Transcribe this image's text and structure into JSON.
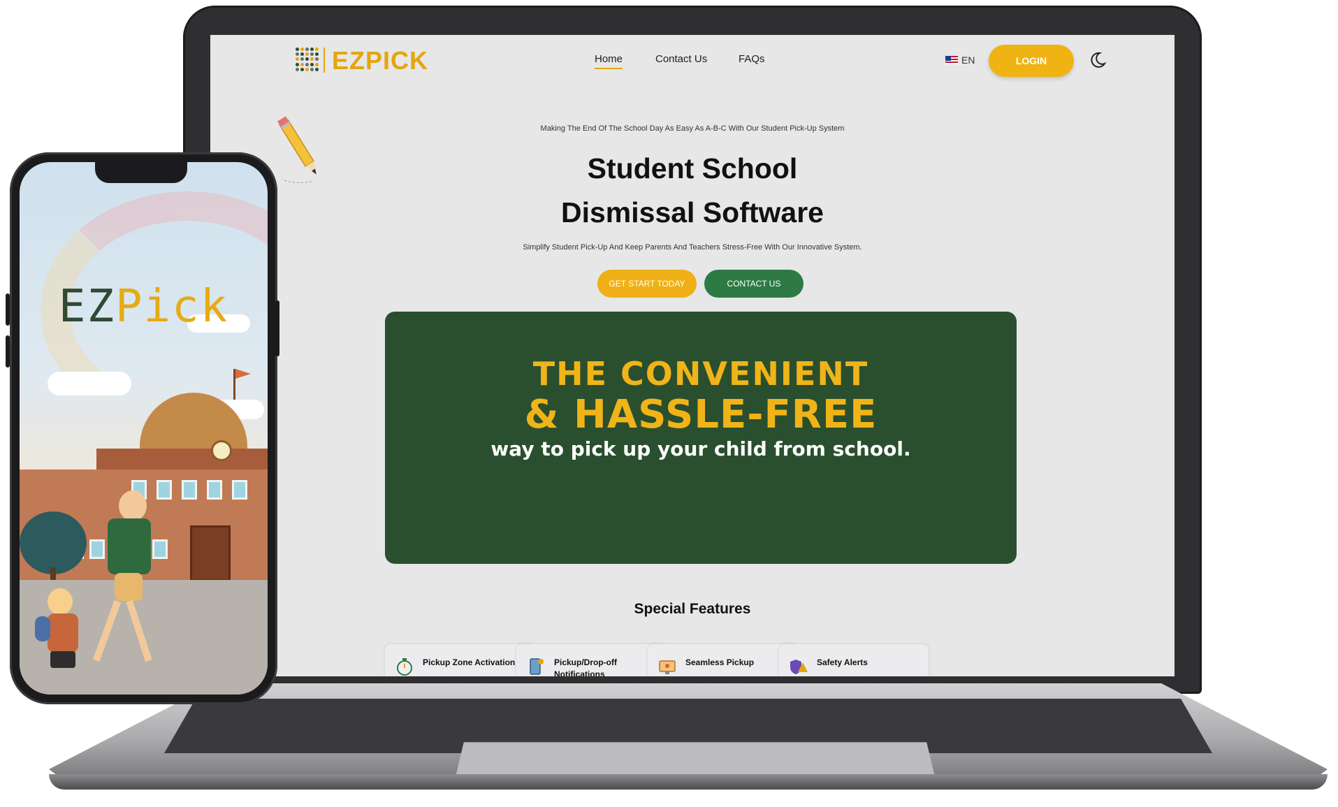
{
  "brand": {
    "name": "EZPICK",
    "accent": "#e5a50d",
    "green": "#2a4f2e"
  },
  "nav": {
    "links": [
      {
        "label": "Home",
        "active": true
      },
      {
        "label": "Contact Us",
        "active": false
      },
      {
        "label": "FAQs",
        "active": false
      }
    ],
    "language": "EN",
    "login_label": "LOGIN",
    "theme_icon": "moon-icon"
  },
  "hero": {
    "tagline": "Making The End Of The School Day As Easy As A-B-C With Our Student Pick-Up System",
    "title_line1": "Student School",
    "title_line2": "Dismissal Software",
    "subtitle": "Simplify Student Pick-Up And Keep Parents And Teachers Stress-Free With Our Innovative System.",
    "primary_button": "GET START TODAY",
    "secondary_button": "CONTACT US"
  },
  "banner": {
    "line1": "THE CONVENIENT",
    "line2": "& HASSLE-FREE",
    "line3": "way to pick up your child from school."
  },
  "features": {
    "title": "Special Features",
    "items": [
      {
        "label": "Pickup Zone Activation",
        "icon": "stopwatch-icon"
      },
      {
        "label": "Pickup/Drop-off Notifications",
        "icon": "phone-notification-icon"
      },
      {
        "label": "Seamless Pickup",
        "icon": "monitor-pickup-icon"
      },
      {
        "label": "Safety Alerts",
        "icon": "shield-alert-icon"
      }
    ]
  },
  "phone": {
    "title_ez": "EZ",
    "title_pick": "Pick"
  }
}
